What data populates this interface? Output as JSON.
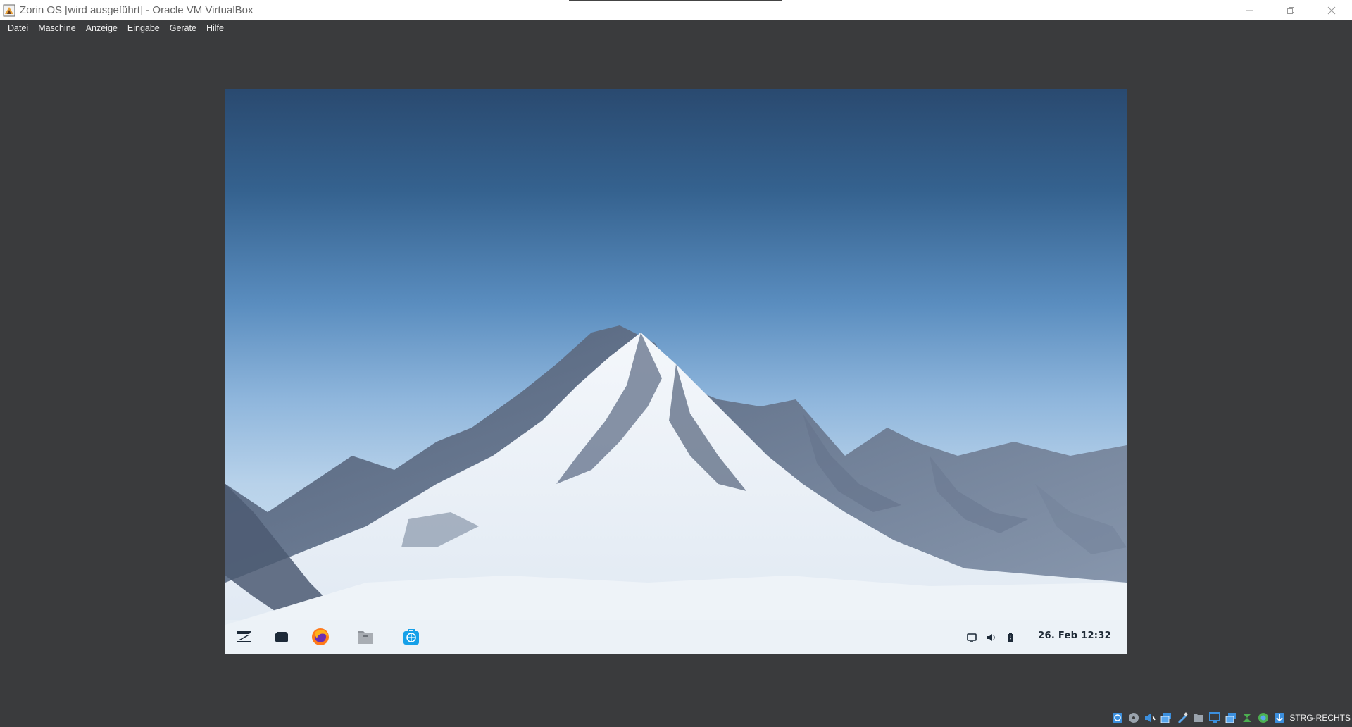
{
  "window": {
    "title": "Zorin OS [wird ausgeführt] - Oracle VM VirtualBox",
    "app_icon": "virtualbox-icon",
    "controls": [
      "minimize-icon",
      "restore-icon",
      "close-icon"
    ]
  },
  "menubar": {
    "items": [
      "Datei",
      "Maschine",
      "Anzeige",
      "Eingabe",
      "Geräte",
      "Hilfe"
    ]
  },
  "guest": {
    "wallpaper": "snowy-mountain-peak",
    "taskbar": {
      "launchers": [
        "zorin-menu-icon",
        "desktop-icon",
        "firefox-icon",
        "files-icon",
        "software-store-icon"
      ],
      "tray": [
        "display-icon",
        "volume-icon",
        "battery-icon"
      ],
      "clock": "26. Feb  12:32"
    }
  },
  "statusbar": {
    "icons": [
      "hard-disk-icon",
      "optical-drive-icon",
      "audio-icon",
      "network-icon",
      "usb-icon",
      "shared-folders-icon",
      "display-icon",
      "video-capture-icon",
      "mouse-integration-icon",
      "cpu-icon",
      "keyboard-capture-icon"
    ],
    "host_key": "STRG-RECHTS"
  },
  "colors": {
    "host_background": "#3a3b3d",
    "titlebar": "#ffffff",
    "sky_top": "#2a4a70",
    "sky_bottom": "#d9e7f3"
  }
}
